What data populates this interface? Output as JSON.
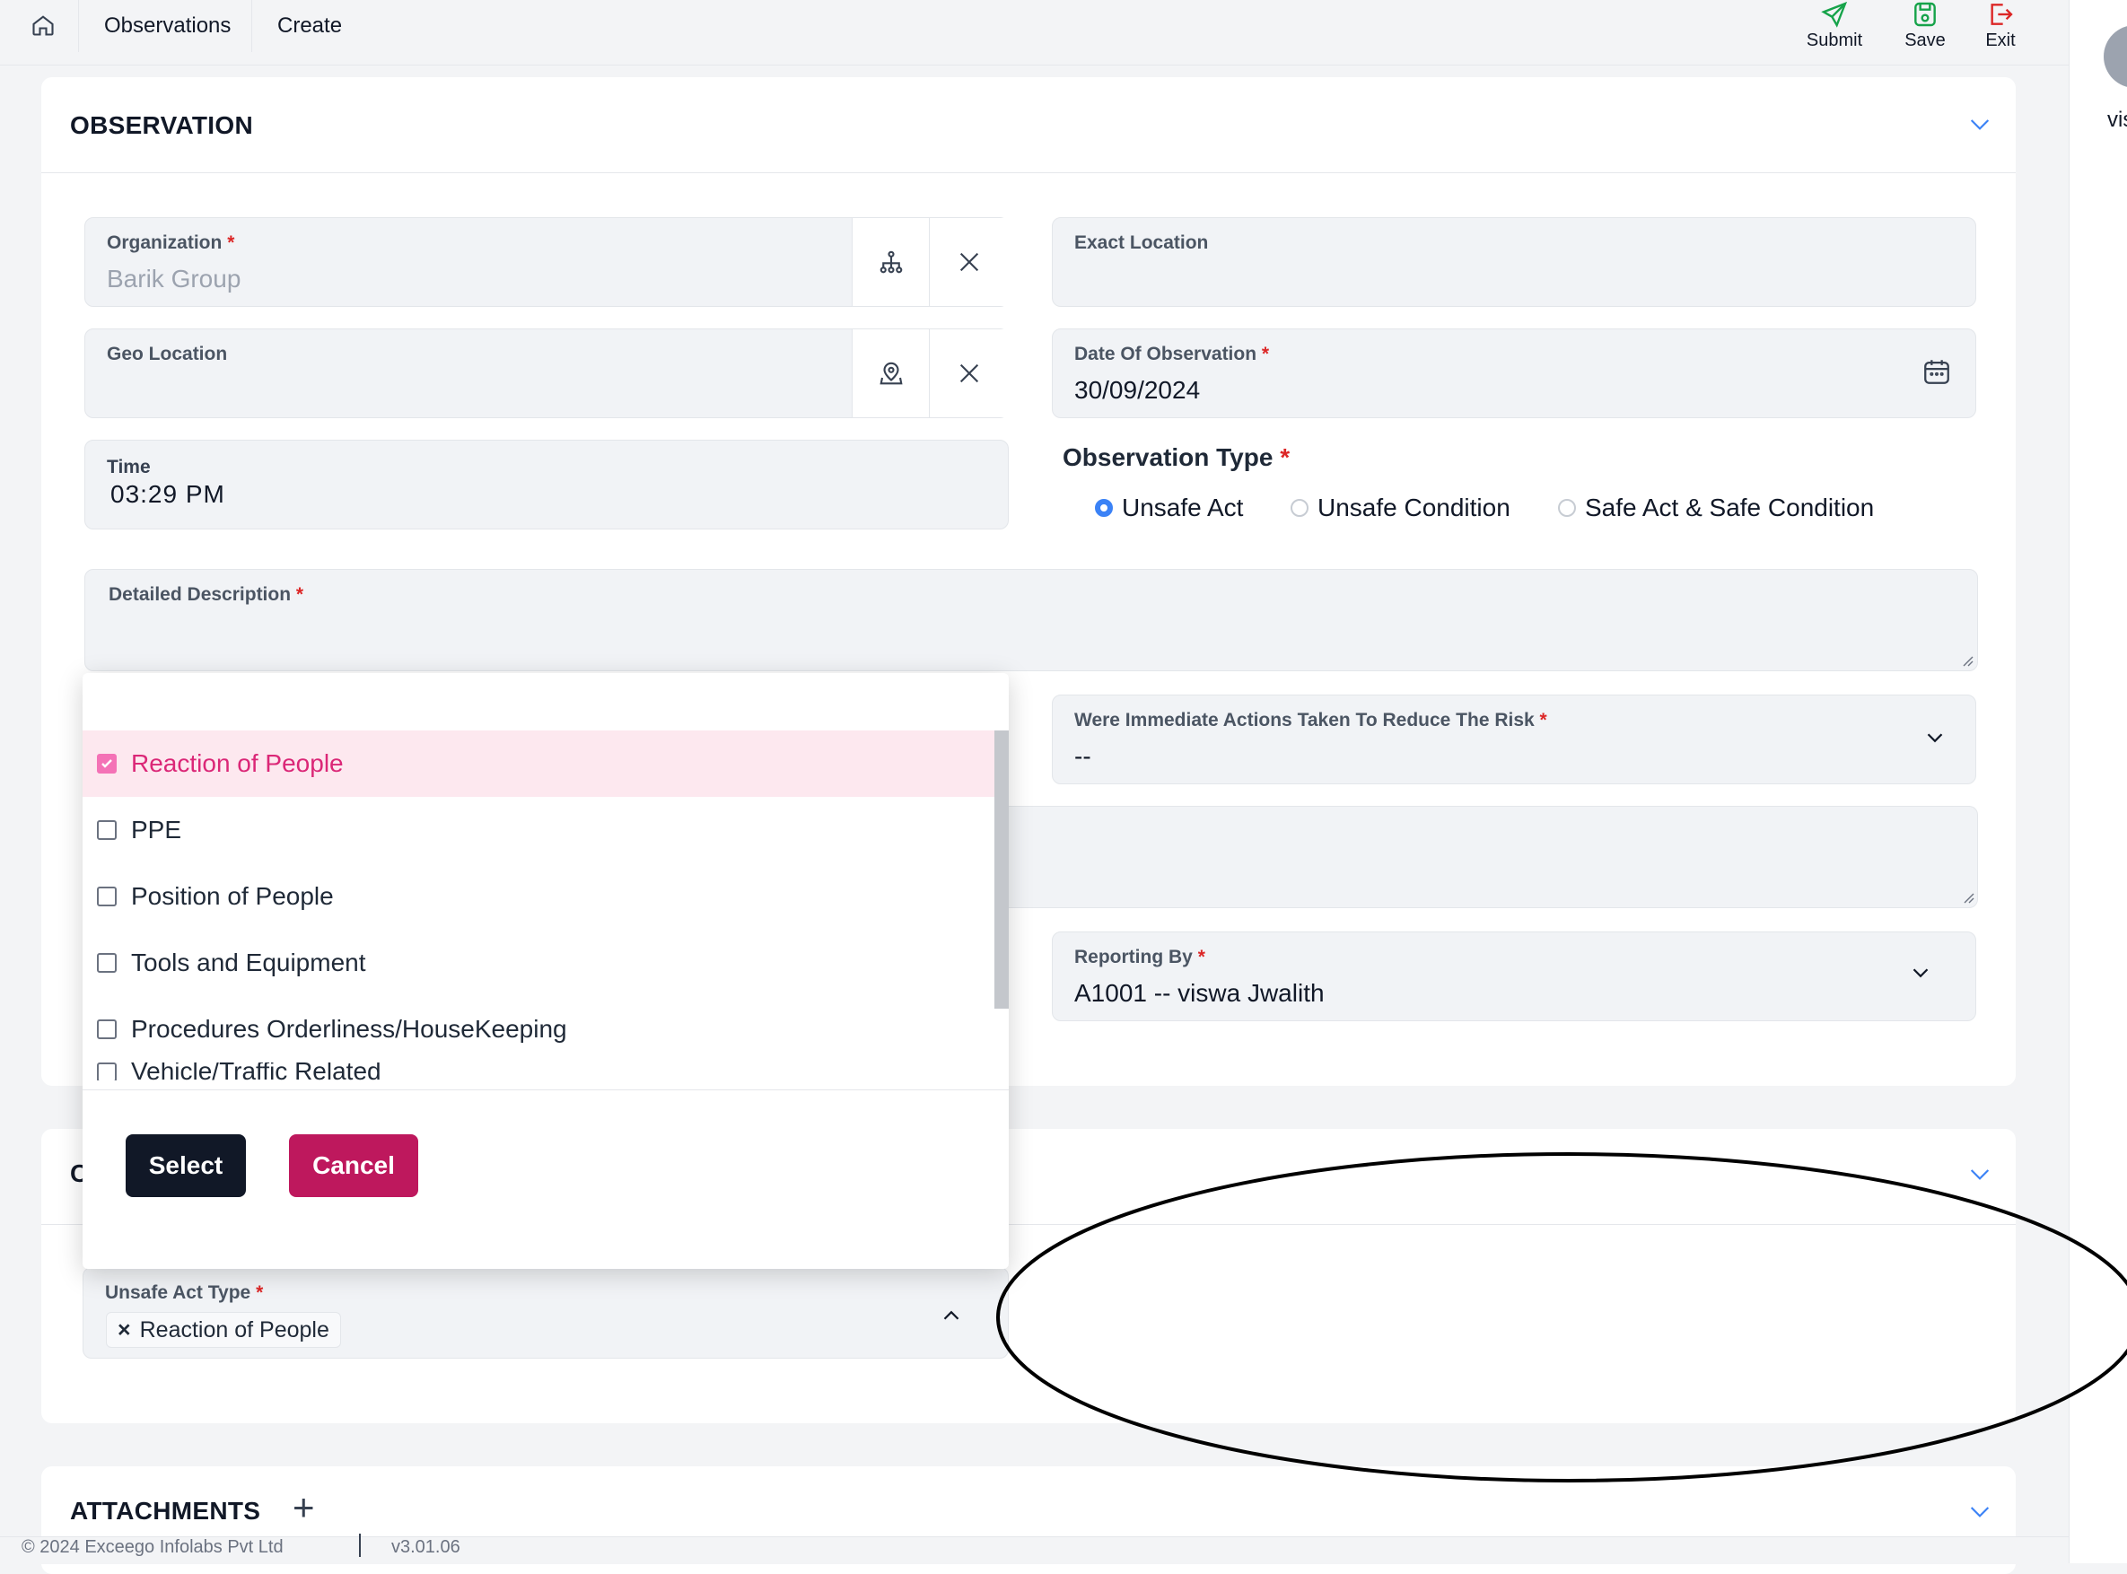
{
  "breadcrumb": {
    "observations": "Observations",
    "create": "Create"
  },
  "toolbar": {
    "submit": "Submit",
    "save": "Save",
    "exit": "Exit"
  },
  "user": {
    "name_partial": "vis"
  },
  "observation_card": {
    "title": "OBSERVATION",
    "organization": {
      "label": "Organization",
      "required": "*",
      "placeholder": "Barik Group"
    },
    "exact_location": {
      "label": "Exact Location"
    },
    "geo_location": {
      "label": "Geo Location"
    },
    "date_of_observation": {
      "label": "Date Of Observation",
      "required": "*",
      "value": "30/09/2024"
    },
    "time": {
      "label": "Time",
      "value": "03:29 PM"
    },
    "observation_type": {
      "label": "Observation Type",
      "required": "*",
      "options": [
        "Unsafe Act",
        "Unsafe Condition",
        "Safe Act & Safe Condition"
      ],
      "selected": "Unsafe Act"
    },
    "detailed_description": {
      "label": "Detailed Description",
      "required": "*"
    },
    "immediate_actions": {
      "label": "Were Immediate Actions Taken To Reduce The Risk",
      "required": "*",
      "value": "--"
    },
    "reporting_by": {
      "label": "Reporting By",
      "required": "*",
      "value": "A1001 -- viswa Jwalith"
    }
  },
  "second_card": {
    "title_partial": "C",
    "unsafe_act_type": {
      "label": "Unsafe Act Type",
      "required": "*",
      "chip": "Reaction of People",
      "chip_remove": "×"
    }
  },
  "attachments": {
    "title": "ATTACHMENTS",
    "add": "+"
  },
  "popup": {
    "options": [
      {
        "label": "Reaction of People",
        "checked": true
      },
      {
        "label": "PPE",
        "checked": false
      },
      {
        "label": "Position of People",
        "checked": false
      },
      {
        "label": "Tools and Equipment",
        "checked": false
      },
      {
        "label": "Procedures Orderliness/HouseKeeping",
        "checked": false
      },
      {
        "label": "Vehicle/Traffic Related",
        "checked": false
      }
    ],
    "select_label": "Select",
    "cancel_label": "Cancel"
  },
  "footer": {
    "copyright": "© 2024 Exceego Infolabs Pvt Ltd",
    "version": "v3.01.06"
  },
  "colors": {
    "accent": "#3b82f6",
    "primary_button": "#111827",
    "cancel_button": "#be185d",
    "selected_option": "#db2777"
  }
}
